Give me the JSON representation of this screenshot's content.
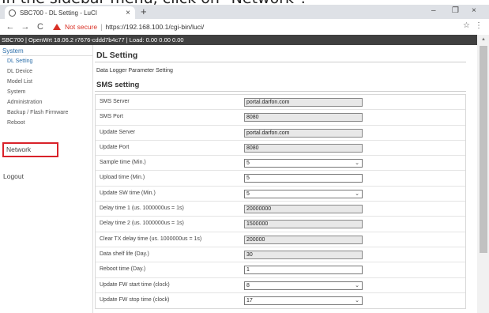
{
  "caption": "In the sidebar menu, click on \"Network\".",
  "browser": {
    "tab_title": "SBC700 - DL Setting - LuCI",
    "tab_close": "×",
    "new_tab": "+",
    "window_controls": {
      "minimize": "–",
      "maximize": "❐",
      "close": "×"
    },
    "nav": {
      "back": "←",
      "forward": "→",
      "reload": "C"
    },
    "not_secure": "Not secure",
    "url": "https://192.168.100.1/cgi-bin/luci/",
    "star": "☆",
    "menu": "⋮"
  },
  "header": {
    "text": "SBC700 | OpenWrt 18.06.2 r7676-cddd7b4c77 | Load: 0.00 0.00 0.00"
  },
  "sidebar": {
    "main": "System",
    "items": [
      {
        "label": "DL Setting",
        "active": true
      },
      {
        "label": "DL Device"
      },
      {
        "label": "Model List"
      },
      {
        "label": "System"
      },
      {
        "label": "Administration"
      },
      {
        "label": "Backup / Flash Firmware"
      },
      {
        "label": "Reboot"
      }
    ],
    "network": "Network",
    "logout": "Logout"
  },
  "main": {
    "title": "DL Setting",
    "description": "Data Logger Parameter Setting",
    "section": "SMS setting",
    "rows": [
      {
        "label": "SMS Server",
        "value": "portal.darfon.com",
        "kind": "ro"
      },
      {
        "label": "SMS Port",
        "value": "8080",
        "kind": "ro"
      },
      {
        "label": "Update Server",
        "value": "portal.darfon.com",
        "kind": "ro"
      },
      {
        "label": "Update Port",
        "value": "8080",
        "kind": "ro"
      },
      {
        "label": "Sample time (Min.)",
        "value": "5",
        "kind": "sel"
      },
      {
        "label": "Upload time (Min.)",
        "value": "5",
        "kind": "edit"
      },
      {
        "label": "Update SW time (Min.)",
        "value": "5",
        "kind": "sel"
      },
      {
        "label": "Delay time 1 (us. 1000000us = 1s)",
        "value": "20000000",
        "kind": "ro"
      },
      {
        "label": "Delay time 2 (us. 1000000us = 1s)",
        "value": "1500000",
        "kind": "ro"
      },
      {
        "label": "Clear TX delay time (us. 1000000us = 1s)",
        "value": "200000",
        "kind": "ro"
      },
      {
        "label": "Data shelf life (Day.)",
        "value": "30",
        "kind": "ro"
      },
      {
        "label": "Reboot time (Day.)",
        "value": "1",
        "kind": "edit"
      },
      {
        "label": "Update FW start time (clock)",
        "value": "8",
        "kind": "sel"
      },
      {
        "label": "Update FW stop time (clock)",
        "value": "17",
        "kind": "sel"
      }
    ],
    "chevron": "⌄"
  },
  "colors": {
    "accent": "#2b6da8",
    "highlight": "#d9222a",
    "header": "#404040"
  }
}
